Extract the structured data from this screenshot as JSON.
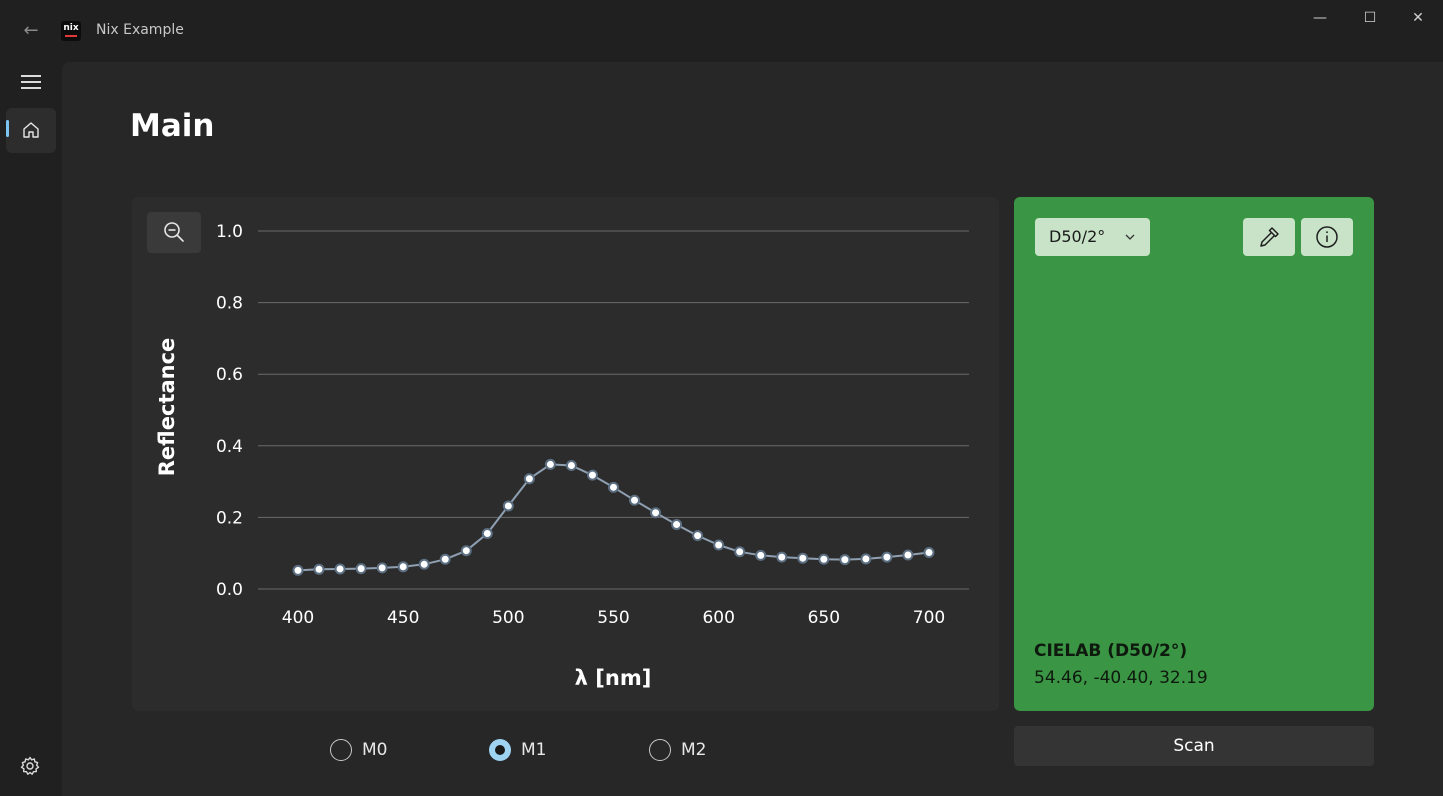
{
  "window": {
    "title": "Nix Example",
    "logo_text": "nix",
    "minimize_glyph": "—",
    "maximize_glyph": "☐",
    "close_glyph": "✕",
    "back_glyph": "←"
  },
  "nav": {
    "items": [
      {
        "icon": "home-icon",
        "selected": true
      }
    ],
    "footer_icon": "gear-icon",
    "accent": "#7ec4f0"
  },
  "page": {
    "title": "Main"
  },
  "chart_data": {
    "type": "line",
    "xlabel": "λ [nm]",
    "ylabel": "Reflectance",
    "xlim": [
      400,
      700
    ],
    "ylim": [
      0,
      1
    ],
    "x_ticks": [
      400,
      450,
      500,
      550,
      600,
      650,
      700
    ],
    "y_ticks": [
      "0.0",
      "0.2",
      "0.4",
      "0.6",
      "0.8",
      "1.0"
    ],
    "grid": "horizontal",
    "x": [
      400,
      410,
      420,
      430,
      440,
      450,
      460,
      470,
      480,
      490,
      500,
      510,
      520,
      530,
      540,
      550,
      560,
      570,
      580,
      590,
      600,
      610,
      620,
      630,
      640,
      650,
      660,
      670,
      680,
      690,
      700
    ],
    "series": [
      {
        "values": [
          0.052,
          0.055,
          0.056,
          0.057,
          0.059,
          0.062,
          0.069,
          0.083,
          0.107,
          0.155,
          0.232,
          0.308,
          0.348,
          0.345,
          0.318,
          0.284,
          0.248,
          0.213,
          0.18,
          0.149,
          0.123,
          0.104,
          0.094,
          0.089,
          0.086,
          0.083,
          0.082,
          0.084,
          0.089,
          0.095,
          0.102
        ],
        "color": "#8fa0b2"
      }
    ]
  },
  "measurement_modes": {
    "options": [
      "M0",
      "M1",
      "M2"
    ],
    "selected": "M1"
  },
  "color_panel": {
    "swatch_color": "#3a9544",
    "illuminant": "D50/2°",
    "lab_title": "CIELAB (D50/2°)",
    "lab_values": "54.46, -40.40, 32.19",
    "picker_icon": "eyedropper-icon",
    "info_icon": "info-icon"
  },
  "actions": {
    "scan_label": "Scan"
  }
}
